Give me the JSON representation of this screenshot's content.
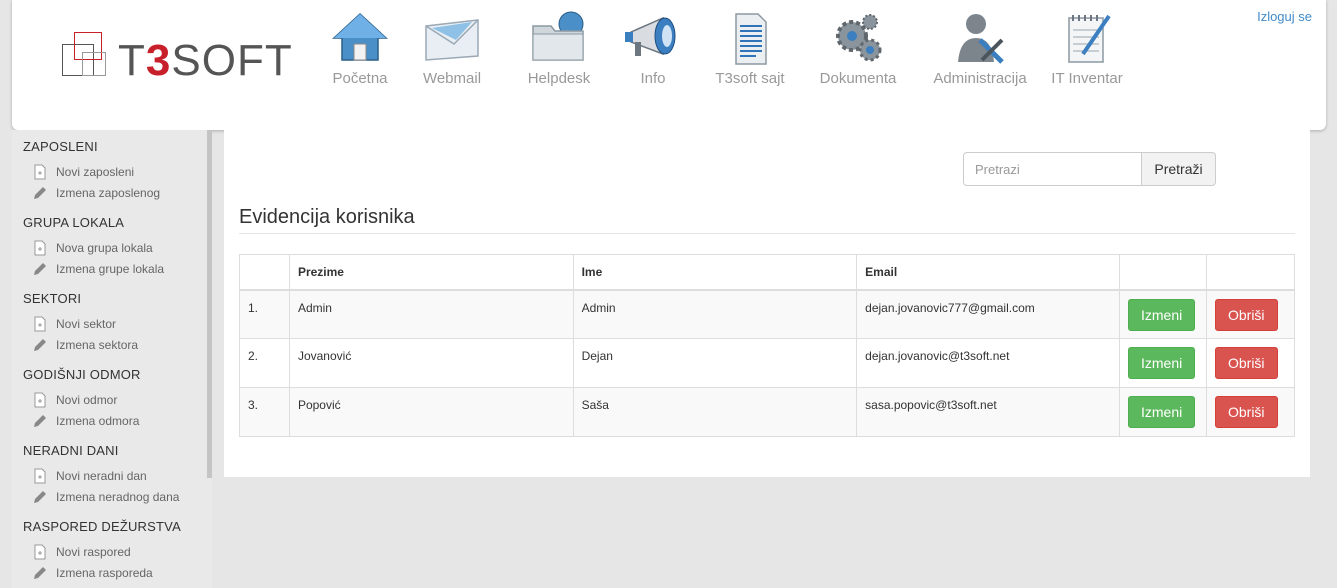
{
  "header": {
    "logo_text": "T3SOFT",
    "logout_label": "Izloguj se",
    "nav": [
      {
        "label": "Početna",
        "icon": "home-icon"
      },
      {
        "label": "Webmail",
        "icon": "envelope-icon"
      },
      {
        "label": "Helpdesk",
        "icon": "folder-globe-icon"
      },
      {
        "label": "Info",
        "icon": "megaphone-icon"
      },
      {
        "label": "T3soft sajt",
        "icon": "document-icon"
      },
      {
        "label": "Dokumenta",
        "icon": "gears-icon"
      },
      {
        "label": "Administracija",
        "icon": "admin-user-icon"
      },
      {
        "label": "IT Inventar",
        "icon": "notepad-pen-icon"
      }
    ]
  },
  "sidebar": {
    "sections": [
      {
        "title": "ZAPOSLENI",
        "add": "Novi zaposleni",
        "edit": "Izmena zaposlenog"
      },
      {
        "title": "GRUPA LOKALA",
        "add": "Nova grupa lokala",
        "edit": "Izmena grupe lokala"
      },
      {
        "title": "SEKTORI",
        "add": "Novi sektor",
        "edit": "Izmena sektora"
      },
      {
        "title": "GODIŠNJI ODMOR",
        "add": "Novi odmor",
        "edit": "Izmena odmora"
      },
      {
        "title": "NERADNI DANI",
        "add": "Novi neradni dan",
        "edit": "Izmena neradnog dana"
      },
      {
        "title": "RASPORED DEŽURSTVA",
        "add": "Novi raspored",
        "edit": "Izmena rasporeda"
      }
    ]
  },
  "main": {
    "search_placeholder": "Pretrazi",
    "search_button": "Pretraži",
    "title": "Evidencija korisnika",
    "table": {
      "headers": [
        "",
        "Prezime",
        "Ime",
        "Email",
        "",
        ""
      ],
      "rows": [
        {
          "num": "1.",
          "prezime": "Admin",
          "ime": "Admin",
          "email": "dejan.jovanovic777@gmail.com"
        },
        {
          "num": "2.",
          "prezime": "Jovanović",
          "ime": "Dejan",
          "email": "dejan.jovanovic@t3soft.net"
        },
        {
          "num": "3.",
          "prezime": "Popović",
          "ime": "Saša",
          "email": "sasa.popovic@t3soft.net"
        }
      ],
      "edit_label": "Izmeni",
      "delete_label": "Obriši"
    }
  },
  "colors": {
    "accent_blue": "#428bca",
    "logo_red": "#c8202b",
    "button_green": "#5cb85c",
    "button_red": "#d9534f"
  }
}
